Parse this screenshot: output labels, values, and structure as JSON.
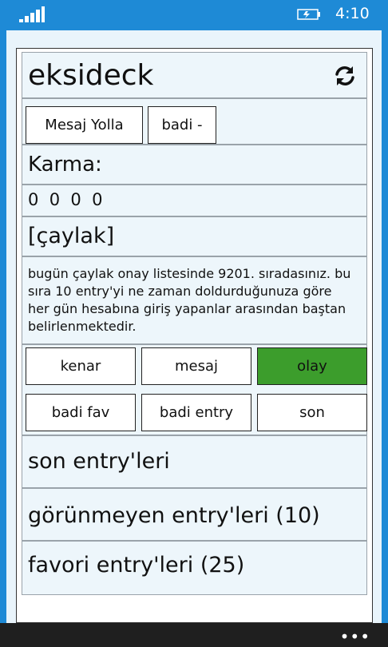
{
  "status": {
    "time": "4:10",
    "signal_icon": "signal-bars-icon",
    "battery_icon": "battery-charging-icon"
  },
  "header": {
    "title": "eksideck",
    "refresh_icon": "refresh-icon"
  },
  "profile_actions": {
    "send_message": "Mesaj Yolla",
    "buddy": "badi -"
  },
  "karma": {
    "label": "Karma:",
    "values": "0  0  0  0"
  },
  "rank": {
    "label": "[çaylak]"
  },
  "notice": {
    "text": "bugün çaylak onay listesinde 9201. sıradasınız. bu sıra 10 entry'yi ne zaman doldurduğunuza göre her gün hesabına giriş yapanlar arasından baştan belirlenmektedir."
  },
  "tabs": {
    "row1": [
      "kenar",
      "mesaj",
      "olay"
    ],
    "row2": [
      "badi fav",
      "badi entry",
      "son"
    ],
    "active": "olay",
    "active_color": "#3c9d2c"
  },
  "lists": [
    {
      "label": "son entry'leri"
    },
    {
      "label": "görünmeyen entry'leri (10)"
    },
    {
      "label": "favori entry'leri (25)"
    }
  ],
  "app_bar": {
    "more": "•••"
  },
  "colors": {
    "accent": "#1e8ad6",
    "panel": "#edf6fb"
  }
}
